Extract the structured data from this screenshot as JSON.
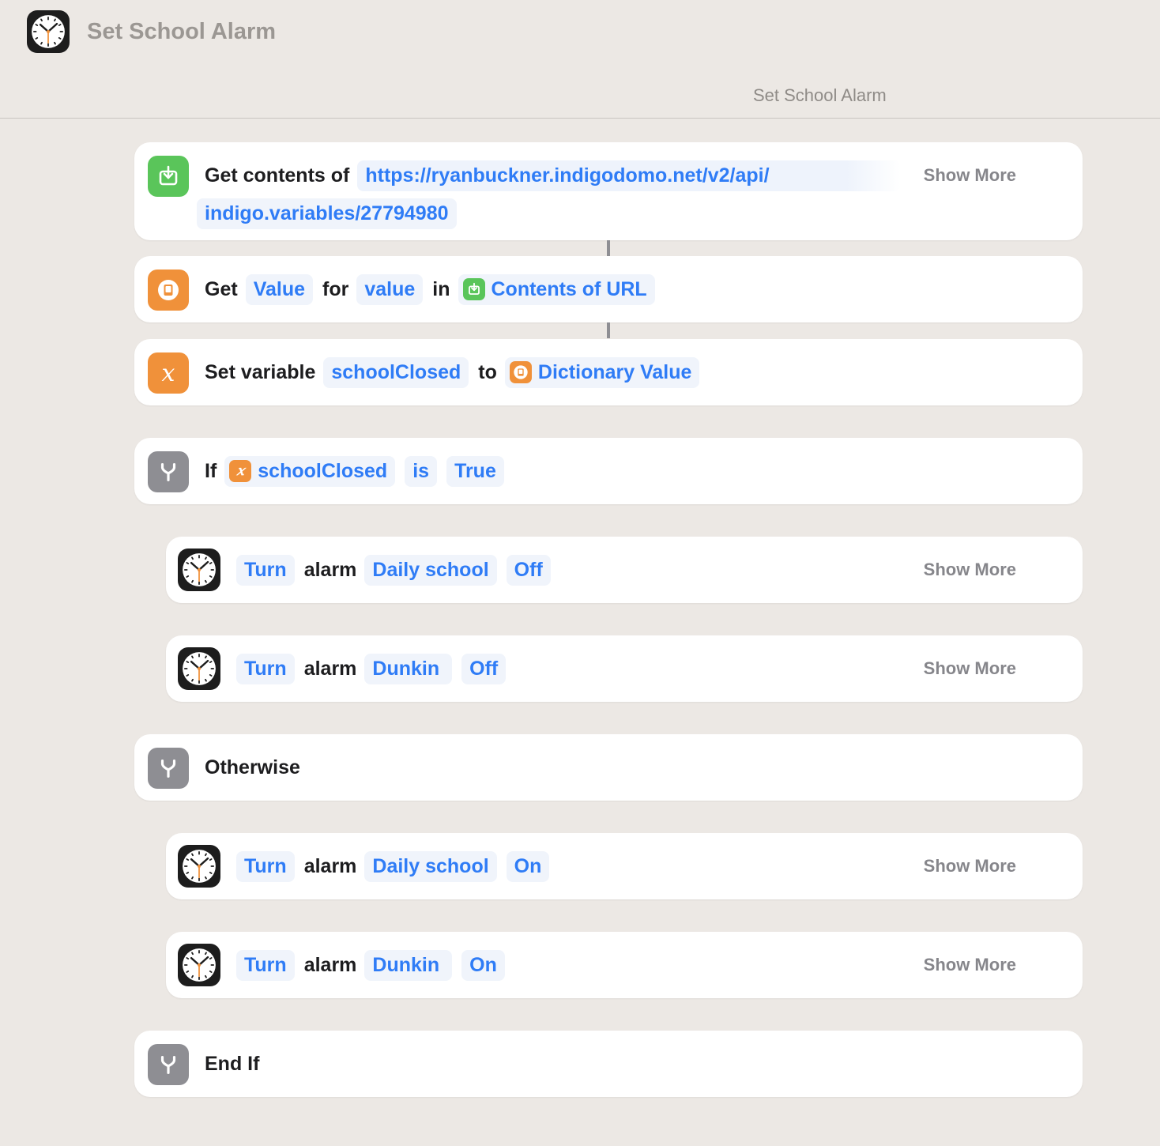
{
  "window": {
    "title": "Set School Alarm",
    "subtitle": "Set School Alarm",
    "app_icon": "clock-icon"
  },
  "actions": {
    "get_contents": {
      "icon": "download-icon",
      "label": "Get contents of",
      "url_line1": "https://ryanbuckner.indigodomo.net/v2/api/",
      "url_line2": "indigo.variables/27794980",
      "show_more": "Show More"
    },
    "get_value": {
      "icon": "dictionary-icon",
      "label_get": "Get",
      "token_value": "Value",
      "label_for": "for",
      "token_key": "value",
      "label_in": "in",
      "token_source": "Contents of URL"
    },
    "set_variable": {
      "icon": "variable-icon",
      "label_set": "Set variable",
      "token_name": "schoolClosed",
      "label_to": "to",
      "token_source": "Dictionary Value"
    },
    "if_block": {
      "icon": "branch-icon",
      "label_if": "If",
      "token_var": "schoolClosed",
      "token_op": "is",
      "token_value": "True"
    },
    "alarm_1": {
      "token_turn": "Turn",
      "label_alarm": "alarm",
      "token_name": "Daily school",
      "token_state": "Off",
      "show_more": "Show More"
    },
    "alarm_2": {
      "token_turn": "Turn",
      "label_alarm": "alarm",
      "token_name": "Dunkin",
      "token_state": "Off",
      "show_more": "Show More"
    },
    "otherwise": {
      "icon": "branch-icon",
      "label": "Otherwise"
    },
    "alarm_3": {
      "token_turn": "Turn",
      "label_alarm": "alarm",
      "token_name": "Daily school",
      "token_state": "On",
      "show_more": "Show More"
    },
    "alarm_4": {
      "token_turn": "Turn",
      "label_alarm": "alarm",
      "token_name": "Dunkin",
      "token_state": "On",
      "show_more": "Show More"
    },
    "end_if": {
      "icon": "branch-icon",
      "label": "End If"
    }
  },
  "colors": {
    "background": "#ece8e4",
    "card": "#ffffff",
    "token_text": "#2f7cf6",
    "green": "#5ac55a",
    "orange": "#f0913a",
    "gray": "#8e8e93"
  }
}
